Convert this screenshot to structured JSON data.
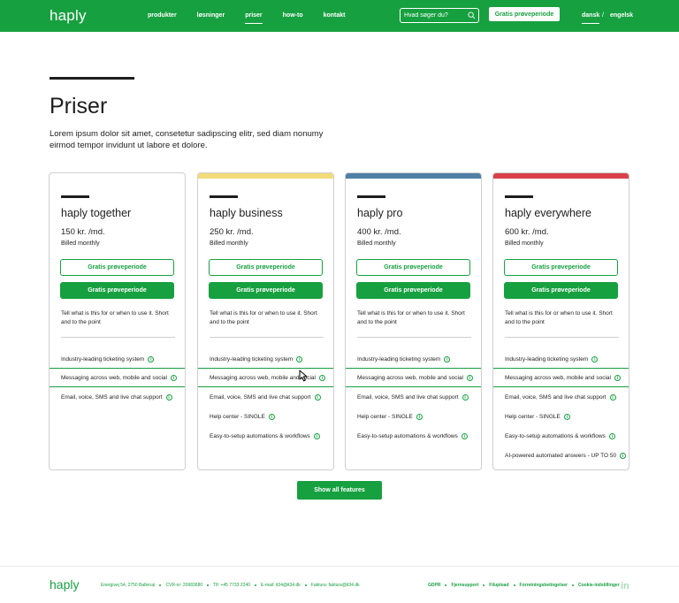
{
  "nav": {
    "logo": "haply",
    "links": [
      "produkter",
      "løsninger",
      "priser",
      "how-to",
      "kontakt"
    ],
    "search_placeholder": "Hvad søger du?",
    "trial_button": "Gratis prøveperiode",
    "languages": [
      "dansk",
      "/",
      "engelsk"
    ]
  },
  "hero": {
    "title": "Priser",
    "intro": "Lorem ipsum dolor sit amet, consetetur sadipscing elitr, sed diam nonumy eirmod tempor invidunt ut labore et dolore."
  },
  "colors": {
    "brand": "#17a040",
    "accent_business": "#f2dc7a",
    "accent_pro": "#4f7fa6",
    "accent_everywhere": "#d9414a"
  },
  "plans": [
    {
      "title": "haply together",
      "price": "150 kr. /md.",
      "billing": "Billed monthly",
      "btn_outline": "Gratis prøveperiode",
      "btn_solid": "Gratis prøveperiode",
      "description": "Tell what is this for or when to use it. Short and to the point",
      "features": [
        "Industry-leading ticketing system",
        "Messaging across web, mobile and social",
        "Email, voice, SMS and live chat support"
      ]
    },
    {
      "title": "haply business",
      "price": "250 kr. /md.",
      "billing": "Billed monthly",
      "btn_outline": "Gratis prøveperiode",
      "btn_solid": "Gratis prøveperiode",
      "description": "Tell what is this for or when to use it. Short and to the point",
      "features": [
        "Industry-leading ticketing system",
        "Messaging across web, mobile and social",
        "Email, voice, SMS and live chat support",
        "Help center - SINGLE",
        "Easy-to-setup automations & workflows"
      ]
    },
    {
      "title": "haply pro",
      "price": "400 kr. /md.",
      "billing": "Billed monthly",
      "btn_outline": "Gratis prøveperiode",
      "btn_solid": "Gratis prøveperiode",
      "description": "Tell what is this for or when to use it. Short and to the point",
      "features": [
        "Industry-leading ticketing system",
        "Messaging across web, mobile and social",
        "Email, voice, SMS and live chat support",
        "Help center - SINGLE",
        "Easy-to-setup automations & workflows"
      ]
    },
    {
      "title": "haply everywhere",
      "price": "600 kr. /md.",
      "billing": "Billed monthly",
      "btn_outline": "Gratis prøveperiode",
      "btn_solid": "Gratis prøveperiode",
      "description": "Tell what is this for or when to use it. Short and to the point",
      "features": [
        "Industry-leading ticketing system",
        "Messaging across web, mobile and social",
        "Email, voice, SMS and live chat support",
        "Help center - SINGLE",
        "Easy-to-setup automations & workflows",
        "AI-powered automated answers - UP TO 50"
      ]
    }
  ],
  "show_all_button": "Show all features",
  "footer": {
    "logo": "haply",
    "info": [
      "Energivej 54, 2750 Ballerup",
      "CVR-nr: 20683680",
      "Tlf: +45 7733 2240",
      "E-mail: it34@it34.dk",
      "Faktura: faktura@it34.dk"
    ],
    "links": [
      "GDPR",
      "Fjernsupport",
      "Filupload",
      "Forretningsbetingelser",
      "Cookie-indstillinger"
    ],
    "social_icon": "linkedin-icon",
    "social_label": "in"
  }
}
